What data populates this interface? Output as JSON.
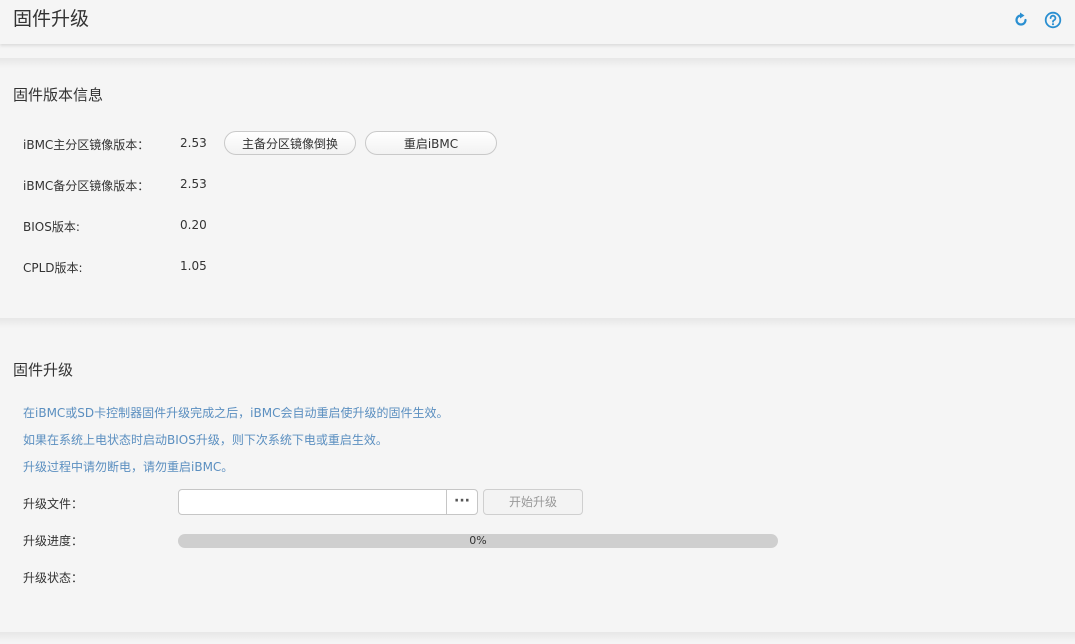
{
  "header": {
    "title": "固件升级",
    "refresh_icon": "refresh-icon",
    "help_icon": "help-icon",
    "accent_color": "#2a8fd1"
  },
  "version_info": {
    "title": "固件版本信息",
    "rows": [
      {
        "label": "iBMC主分区镜像版本：",
        "value": "2.53"
      },
      {
        "label": "iBMC备分区镜像版本：",
        "value": "2.53"
      },
      {
        "label": "BIOS版本:",
        "value": "0.20"
      },
      {
        "label": "CPLD版本:",
        "value": "1.05"
      }
    ],
    "switch_button": "主备分区镜像倒换",
    "restart_button": "重启iBMC"
  },
  "upgrade": {
    "title": "固件升级",
    "notes": [
      "在iBMC或SD卡控制器固件升级完成之后，iBMC会自动重启使升级的固件生效。",
      "如果在系统上电状态时启动BIOS升级，则下次系统下电或重启生效。",
      "升级过程中请勿断电，请勿重启iBMC。"
    ],
    "note_color": "#5b8fc0",
    "file_label": "升级文件：",
    "file_value": "",
    "browse_label": "···",
    "start_button": "开始升级",
    "progress_label": "升级进度：",
    "progress_percent": 0,
    "progress_text": "0%",
    "status_label": "升级状态：",
    "status_value": ""
  }
}
